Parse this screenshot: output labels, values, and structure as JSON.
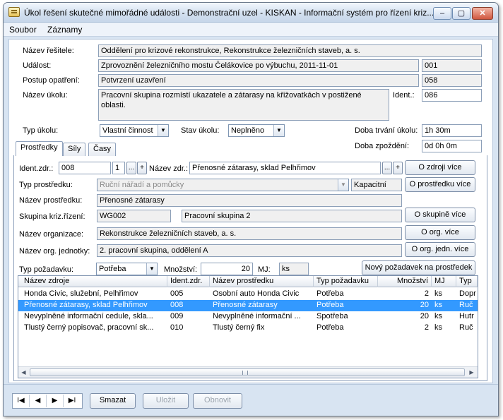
{
  "window": {
    "title": "Úkol řešení skutečné mimořádné události - Demonstrační uzel - KISKAN - Informační systém pro řízení kriz...",
    "controls": {
      "minimize": "–",
      "maximize": "▢",
      "close": "✕"
    }
  },
  "menu": [
    "Soubor",
    "Záznamy"
  ],
  "form": {
    "resitel_label": "Název řešitele:",
    "resitel_value": "Oddělení pro krizové rekonstrukce, Rekonstrukce železničních staveb, a. s.",
    "udalost_label": "Událost:",
    "udalost_value": "Zprovoznění železničního mostu Čelákovice po výbuchu, 2011-11-01",
    "udalost_code": "001",
    "postup_label": "Postup opatření:",
    "postup_value": "Potvrzení uzavření",
    "postup_code": "058",
    "ukol_label": "Název úkolu:",
    "ukol_value": "Pracovní skupina rozmístí ukazatele a zátarasy na křižovatkách v postižené oblasti.",
    "ident_label": "Ident.:",
    "ident_value": "086",
    "typ_ukolu_label": "Typ úkolu:",
    "typ_ukolu_value": "Vlastní činnost",
    "stav_ukolu_label": "Stav úkolu:",
    "stav_ukolu_value": "Neplněno",
    "doba_trvani_label": "Doba trvání úkolu:",
    "doba_trvani_value": "1h 30m",
    "doba_zpozdeni_label": "Doba zpoždění:",
    "doba_zpozdeni_value": "0d 0h 0m"
  },
  "tabs": [
    "Prostředky",
    "Síly",
    "Časy"
  ],
  "resource": {
    "ident_zdr_label": "Ident.zdr.:",
    "ident_zdr_value": "008",
    "ident_zdr_num": "1",
    "nazev_zdr_label": "Název zdr.:",
    "nazev_zdr_value": "Přenosné zátarasy, sklad Pelhřimov",
    "typ_prostredku_label": "Typ prostředku:",
    "typ_prostredku_value": "Ruční nářadí a pomůcky",
    "kapacitni": "Kapacitní",
    "nazev_prostredku_label": "Název prostředku:",
    "nazev_prostredku_value": "Přenosné zátarasy",
    "skupina_label": "Skupina kriz.řízení:",
    "skupina_code": "WG002",
    "skupina_value": "Pracovní skupina 2",
    "organizace_label": "Název organizace:",
    "organizace_value": "Rekonstrukce železničních staveb, a. s.",
    "org_jednotky_label": "Název org. jednotky:",
    "org_jednotky_value": "2. pracovní skupina, oddělení A",
    "typ_pozadavku_label": "Typ požadavku:",
    "typ_pozadavku_value": "Potřeba",
    "mnozstvi_label": "Množství:",
    "mnozstvi_value": "20",
    "mj_label": "MJ:",
    "mj_value": "ks"
  },
  "buttons": {
    "dots": "...",
    "plus": "+",
    "o_zdroji": "O zdroji více",
    "o_prostredku": "O prostředku více",
    "o_skupine": "O skupině více",
    "o_org": "O org. více",
    "o_org_jedn": "O org. jedn. více",
    "novy_pozadavek": "Nový požadavek na prostředek",
    "smazat": "Smazat",
    "ulozit": "Uložit",
    "obnovit": "Obnovit"
  },
  "table": {
    "columns": [
      "Název zdroje",
      "Ident.zdr.",
      "Název prostředku",
      "Typ požadavku",
      "Množství",
      "MJ",
      "Typ"
    ],
    "rows": [
      [
        "Honda Civic, služební, Pelhřimov",
        "005",
        "Osobní auto Honda Civic",
        "Potřeba",
        "2",
        "ks",
        "Dopr"
      ],
      [
        "Přenosné zátarasy, sklad Pelhřimov",
        "008",
        "Přenosné zátarasy",
        "Potřeba",
        "20",
        "ks",
        "Ruč"
      ],
      [
        "Nevyplněné informační cedule, skla...",
        "009",
        "Nevyplněné informační ...",
        "Spotřeba",
        "20",
        "ks",
        "Hutr"
      ],
      [
        "Tlustý černý popisovač, pracovní sk...",
        "010",
        "Tlustý černý fix",
        "Potřeba",
        "2",
        "ks",
        "Ruč"
      ]
    ],
    "selected_row": 1
  },
  "nav": {
    "first": "I◀",
    "prev": "◀",
    "next": "▶",
    "last": "▶I"
  }
}
